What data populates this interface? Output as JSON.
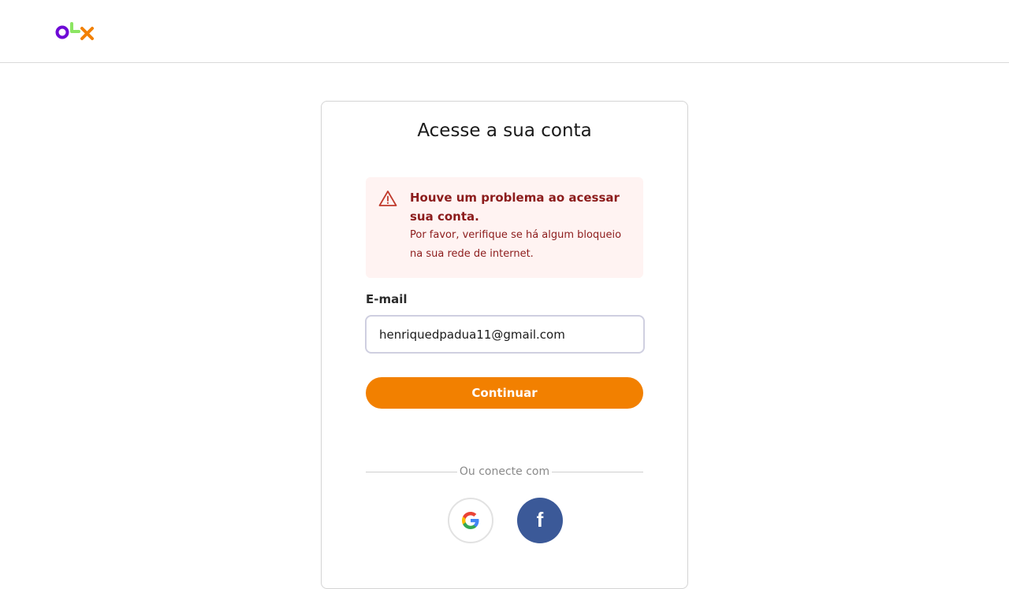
{
  "header": {
    "logo_text": "OLX",
    "logo_colors": {
      "o": "#6e0ad6",
      "l": "#8ce563",
      "x": "#f28000"
    }
  },
  "card": {
    "title": "Acesse a sua conta",
    "alert": {
      "icon": "warning-triangle-icon",
      "title": "Houve um problema ao acessar sua conta.",
      "message": "Por favor, verifique se há algum bloqueio na sua rede de internet.",
      "color": "#8c1c1c",
      "background": "#fff3f2"
    },
    "email": {
      "label": "E-mail",
      "value": "henriquedpadua11@gmail.com",
      "placeholder": ""
    },
    "continue_label": "Continuar",
    "divider_text": "Ou conecte com",
    "social": {
      "google_icon": "google-icon",
      "facebook_icon": "facebook-icon",
      "facebook_letter": "f",
      "facebook_color": "#3b5998"
    }
  },
  "colors": {
    "accent": "#f28000"
  }
}
